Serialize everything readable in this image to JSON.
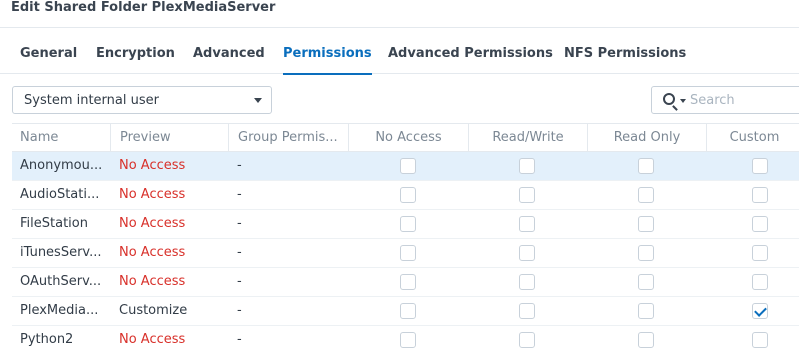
{
  "window": {
    "title": "Edit Shared Folder PlexMediaServer"
  },
  "tabs": [
    {
      "label": "General",
      "active": false
    },
    {
      "label": "Encryption",
      "active": false
    },
    {
      "label": "Advanced",
      "active": false
    },
    {
      "label": "Permissions",
      "active": true
    },
    {
      "label": "Advanced Permissions",
      "active": false
    },
    {
      "label": "NFS Permissions",
      "active": false
    }
  ],
  "user_type_select": {
    "value": "System internal user"
  },
  "search": {
    "placeholder": "Search",
    "value": ""
  },
  "table": {
    "columns": [
      "Name",
      "Preview",
      "Group Permis...",
      "No Access",
      "Read/Write",
      "Read Only",
      "Custom"
    ],
    "rows": [
      {
        "name": "Anonymou...",
        "preview": "No Access",
        "group": "-",
        "no_access": false,
        "read_write": false,
        "read_only": false,
        "custom": false,
        "selected": true
      },
      {
        "name": "AudioStati...",
        "preview": "No Access",
        "group": "-",
        "no_access": false,
        "read_write": false,
        "read_only": false,
        "custom": false,
        "selected": false
      },
      {
        "name": "FileStation",
        "preview": "No Access",
        "group": "-",
        "no_access": false,
        "read_write": false,
        "read_only": false,
        "custom": false,
        "selected": false
      },
      {
        "name": "iTunesServ...",
        "preview": "No Access",
        "group": "-",
        "no_access": false,
        "read_write": false,
        "read_only": false,
        "custom": false,
        "selected": false
      },
      {
        "name": "OAuthServ...",
        "preview": "No Access",
        "group": "-",
        "no_access": false,
        "read_write": false,
        "read_only": false,
        "custom": false,
        "selected": false
      },
      {
        "name": "PlexMedia...",
        "preview": "Customize",
        "group": "-",
        "no_access": false,
        "read_write": false,
        "read_only": false,
        "custom": true,
        "selected": false
      },
      {
        "name": "Python2",
        "preview": "No Access",
        "group": "-",
        "no_access": false,
        "read_write": false,
        "read_only": false,
        "custom": false,
        "selected": false
      }
    ]
  },
  "colors": {
    "accent": "#0a6ebd",
    "no_access_text": "#d8302a",
    "selected_row": "#e3f0fb"
  }
}
